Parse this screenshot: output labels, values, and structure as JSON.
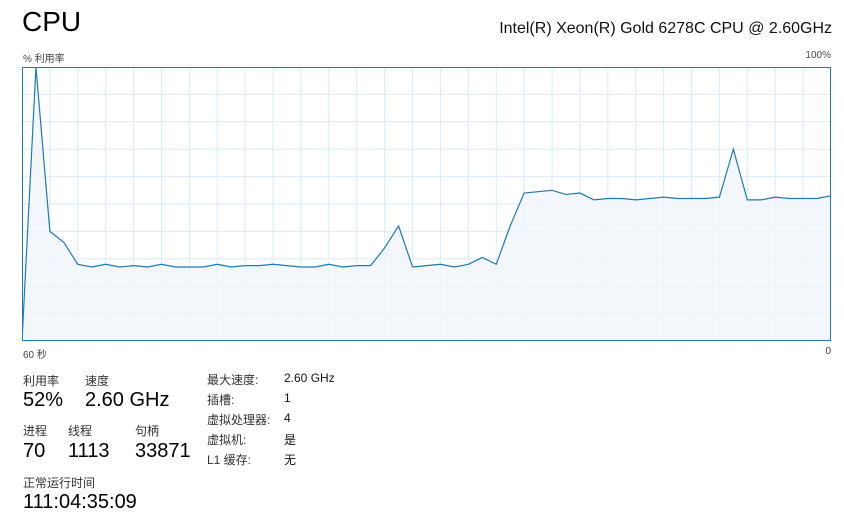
{
  "header": {
    "title": "CPU",
    "cpu_model": "Intel(R) Xeon(R) Gold 6278C CPU @ 2.60GHz"
  },
  "graph": {
    "y_label": "% 利用率",
    "y_max_label": "100%",
    "x_left_label": "60 秒",
    "x_right_label": "0"
  },
  "stats": {
    "utilization": {
      "label": "利用率",
      "value": "52%"
    },
    "speed": {
      "label": "速度",
      "value": "2.60 GHz"
    },
    "processes": {
      "label": "进程",
      "value": "70"
    },
    "threads": {
      "label": "线程",
      "value": "1113"
    },
    "handles": {
      "label": "句柄",
      "value": "33871"
    },
    "uptime": {
      "label": "正常运行时间",
      "value": "111:04:35:09"
    }
  },
  "details": [
    {
      "label": "最大速度:",
      "value": "2.60 GHz"
    },
    {
      "label": "插槽:",
      "value": "1"
    },
    {
      "label": "虚拟处理器:",
      "value": "4"
    },
    {
      "label": "虚拟机:",
      "value": "是"
    },
    {
      "label": "L1 缓存:",
      "value": "无"
    }
  ],
  "colors": {
    "line": "#1c7ab4",
    "fill": "#f1f6fb",
    "grid": "#d9eaf7",
    "border": "#1c7ab4"
  },
  "chart_data": {
    "type": "area",
    "x_range": [
      60,
      0
    ],
    "ylim": [
      0,
      100
    ],
    "grid": true,
    "values": [
      0,
      100,
      40,
      36,
      28,
      27,
      28,
      27,
      27.5,
      27,
      28,
      27,
      27,
      27,
      28,
      27,
      27.5,
      27.5,
      28,
      27.5,
      27,
      27,
      28,
      27,
      27.5,
      27.5,
      34,
      42,
      27,
      27.5,
      28,
      27,
      28,
      30.5,
      28,
      42,
      54,
      54.5,
      55,
      53.5,
      54,
      51.5,
      52,
      52,
      51.5,
      52,
      52.5,
      52,
      52,
      52,
      52.5,
      70,
      51.5,
      51.5,
      52.5,
      52,
      52,
      52,
      53
    ]
  }
}
